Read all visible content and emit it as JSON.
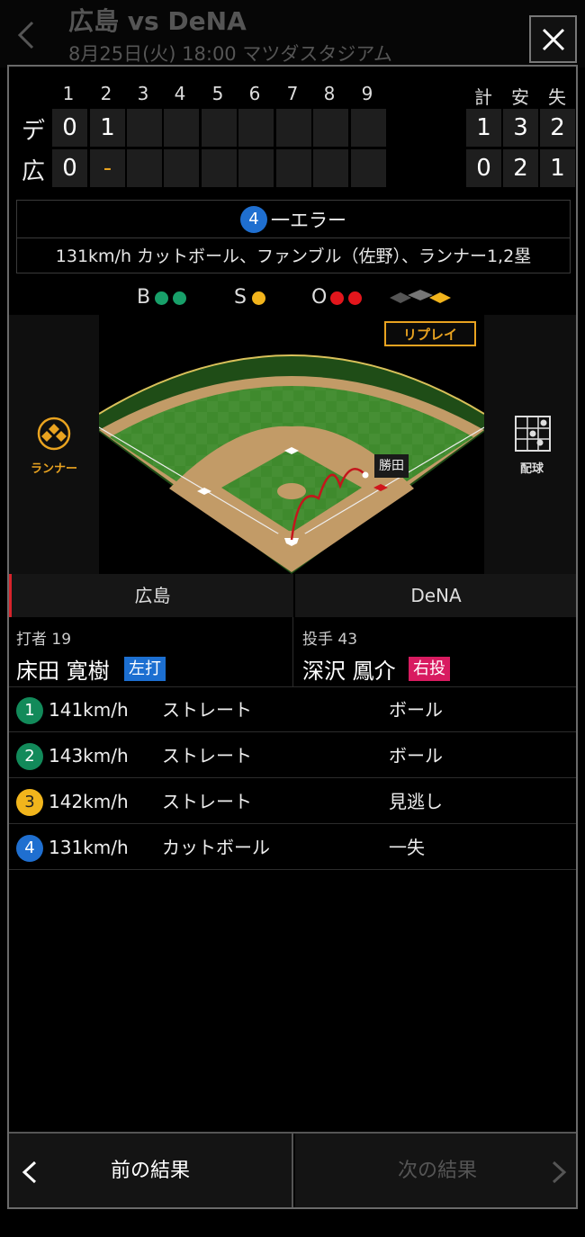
{
  "header": {
    "back_icon": "chevron-left-icon",
    "title": "広島 vs DeNA",
    "subtitle": "8月25日(火) 18:00 マツダスタジアム"
  },
  "close_icon": "close-icon",
  "scoreboard": {
    "innings": [
      "1",
      "2",
      "3",
      "4",
      "5",
      "6",
      "7",
      "8",
      "9"
    ],
    "totals_headers": [
      "計",
      "安",
      "失"
    ],
    "teams": [
      {
        "name": "デ",
        "scores": [
          "0",
          "1",
          "",
          "",
          "",
          "",
          "",
          "",
          ""
        ],
        "totals": [
          "1",
          "3",
          "2"
        ]
      },
      {
        "name": "広",
        "scores": [
          "0",
          "-",
          "",
          "",
          "",
          "",
          "",
          "",
          ""
        ],
        "totals": [
          "0",
          "2",
          "1"
        ]
      }
    ]
  },
  "play": {
    "number": "4",
    "title": "一エラー",
    "description": "131km/h カットボール、ファンブル（佐野）、ランナー1,2塁"
  },
  "count": {
    "ball_label": "B",
    "strike_label": "S",
    "out_label": "O",
    "balls": 2,
    "strikes": 1,
    "outs": 2,
    "colors": {
      "ball": "#18a06a",
      "strike": "#f2b41c",
      "out": "#e3161c"
    }
  },
  "field": {
    "runner_label": "ランナー",
    "replay_label": "リプレイ",
    "pitch_chart_label": "配球",
    "fielder_label": "勝田"
  },
  "teams": {
    "home": {
      "name": "広島",
      "accent": "#d8232a"
    },
    "away": {
      "name": "DeNA",
      "accent": "#1c6fd1"
    }
  },
  "batter": {
    "role": "打者",
    "number": "19",
    "name": "床田 寛樹",
    "hand": "左打",
    "hand_color": "#1c6fd1"
  },
  "pitcher": {
    "role": "投手",
    "number": "43",
    "name": "深沢 鳳介",
    "hand": "右投",
    "hand_color": "#d81b60"
  },
  "pitches": [
    {
      "number": "1",
      "color": "green",
      "speed": "141km/h",
      "type": "ストレート",
      "result": "ボール"
    },
    {
      "number": "2",
      "color": "green",
      "speed": "143km/h",
      "type": "ストレート",
      "result": "ボール"
    },
    {
      "number": "3",
      "color": "yellow",
      "speed": "142km/h",
      "type": "ストレート",
      "result": "見逃し"
    },
    {
      "number": "4",
      "color": "blue",
      "speed": "131km/h",
      "type": "カットボール",
      "result": "一失"
    }
  ],
  "nav": {
    "prev_label": "前の結果",
    "next_label": "次の結果"
  }
}
